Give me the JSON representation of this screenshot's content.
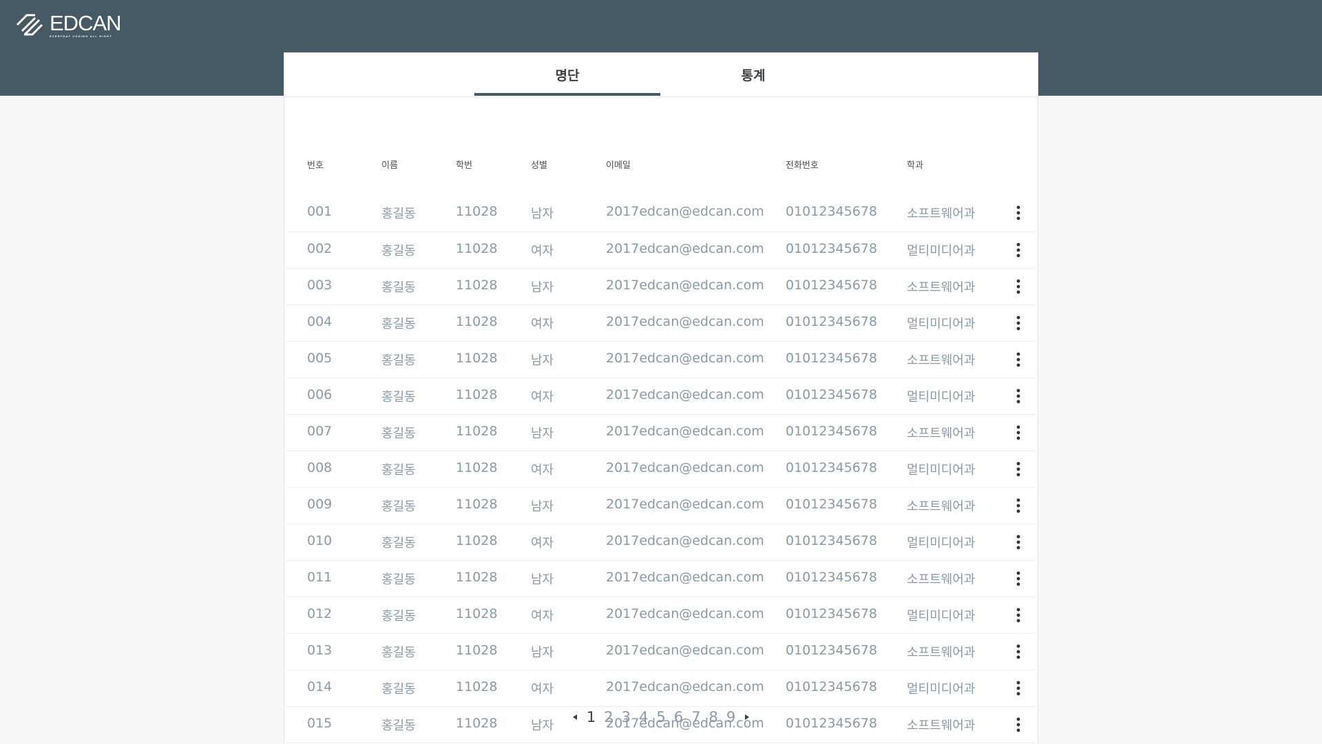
{
  "brand": {
    "name": "EDCAN",
    "tagline": "EVERYDAY CODING ALL NIGHT",
    "header_color": "#465a66"
  },
  "tabs": [
    {
      "label": "명단",
      "active": true
    },
    {
      "label": "통계",
      "active": false
    }
  ],
  "table": {
    "headers": {
      "num": "번호",
      "name": "이름",
      "student_id": "학번",
      "gender": "성별",
      "email": "이메일",
      "phone": "전화번호",
      "department": "학과"
    },
    "rows": [
      {
        "num": "001",
        "name": "홍길동",
        "student_id": "11028",
        "gender": "남자",
        "email": "2017edcan@edcan.com",
        "phone": "01012345678",
        "department": "소프트웨어과"
      },
      {
        "num": "002",
        "name": "홍길동",
        "student_id": "11028",
        "gender": "여자",
        "email": "2017edcan@edcan.com",
        "phone": "01012345678",
        "department": "멀티미디어과"
      },
      {
        "num": "003",
        "name": "홍길동",
        "student_id": "11028",
        "gender": "남자",
        "email": "2017edcan@edcan.com",
        "phone": "01012345678",
        "department": "소프트웨어과"
      },
      {
        "num": "004",
        "name": "홍길동",
        "student_id": "11028",
        "gender": "여자",
        "email": "2017edcan@edcan.com",
        "phone": "01012345678",
        "department": "멀티미디어과"
      },
      {
        "num": "005",
        "name": "홍길동",
        "student_id": "11028",
        "gender": "남자",
        "email": "2017edcan@edcan.com",
        "phone": "01012345678",
        "department": "소프트웨어과"
      },
      {
        "num": "006",
        "name": "홍길동",
        "student_id": "11028",
        "gender": "여자",
        "email": "2017edcan@edcan.com",
        "phone": "01012345678",
        "department": "멀티미디어과"
      },
      {
        "num": "007",
        "name": "홍길동",
        "student_id": "11028",
        "gender": "남자",
        "email": "2017edcan@edcan.com",
        "phone": "01012345678",
        "department": "소프트웨어과"
      },
      {
        "num": "008",
        "name": "홍길동",
        "student_id": "11028",
        "gender": "여자",
        "email": "2017edcan@edcan.com",
        "phone": "01012345678",
        "department": "멀티미디어과"
      },
      {
        "num": "009",
        "name": "홍길동",
        "student_id": "11028",
        "gender": "남자",
        "email": "2017edcan@edcan.com",
        "phone": "01012345678",
        "department": "소프트웨어과"
      },
      {
        "num": "010",
        "name": "홍길동",
        "student_id": "11028",
        "gender": "여자",
        "email": "2017edcan@edcan.com",
        "phone": "01012345678",
        "department": "멀티미디어과"
      },
      {
        "num": "011",
        "name": "홍길동",
        "student_id": "11028",
        "gender": "남자",
        "email": "2017edcan@edcan.com",
        "phone": "01012345678",
        "department": "소프트웨어과"
      },
      {
        "num": "012",
        "name": "홍길동",
        "student_id": "11028",
        "gender": "여자",
        "email": "2017edcan@edcan.com",
        "phone": "01012345678",
        "department": "멀티미디어과"
      },
      {
        "num": "013",
        "name": "홍길동",
        "student_id": "11028",
        "gender": "남자",
        "email": "2017edcan@edcan.com",
        "phone": "01012345678",
        "department": "소프트웨어과"
      },
      {
        "num": "014",
        "name": "홍길동",
        "student_id": "11028",
        "gender": "여자",
        "email": "2017edcan@edcan.com",
        "phone": "01012345678",
        "department": "멀티미디어과"
      },
      {
        "num": "015",
        "name": "홍길동",
        "student_id": "11028",
        "gender": "남자",
        "email": "2017edcan@edcan.com",
        "phone": "01012345678",
        "department": "소프트웨어과"
      }
    ],
    "row_action_icon": "more-vertical-icon"
  },
  "pagination": {
    "pages": [
      "1",
      "2",
      "3",
      "4",
      "5",
      "6",
      "7",
      "8",
      "9"
    ],
    "current": "1",
    "prev_icon": "triangle-left-icon",
    "next_icon": "triangle-right-icon"
  }
}
